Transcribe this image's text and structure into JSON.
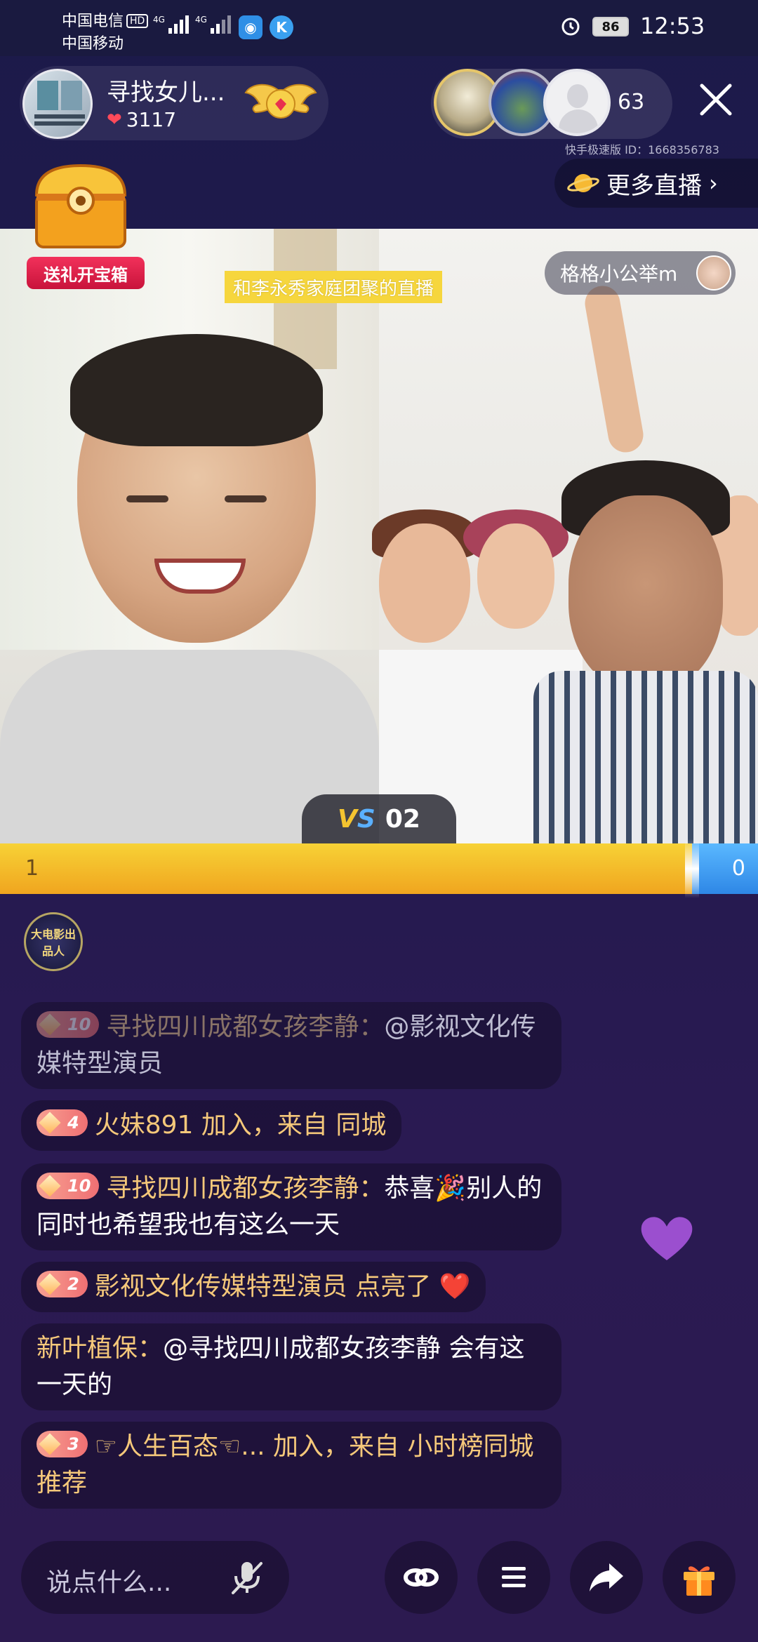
{
  "status_bar": {
    "carrier1": "中国电信",
    "carrier1_hd": "HD",
    "carrier2": "中国移动",
    "net1": "4G",
    "net2": "4G",
    "battery": "86",
    "time": "12:53"
  },
  "host": {
    "name": "寻找女儿...",
    "likes": "3117"
  },
  "viewers": {
    "count": "63",
    "live_id": "快手极速版 ID：1668356783"
  },
  "more_live_label": "更多直播",
  "treasure_label": "送礼开宝箱",
  "video": {
    "topic": "和李永秀家庭团聚的直播",
    "pk_user": "格格小公举m"
  },
  "pk": {
    "vs_round": "02",
    "left_score": "1",
    "right_score": "0"
  },
  "medal_text": "大电影出品人",
  "chat": [
    {
      "level": "10",
      "name": "寻找四川成都女孩李静：",
      "text": "@影视文化传媒特型演员"
    },
    {
      "level": "4",
      "name": "火妹891",
      "text": "加入，来自 同城"
    },
    {
      "level": "10",
      "name": "寻找四川成都女孩李静：",
      "text": "恭喜🎉别人的同时也希望我也有这么一天"
    },
    {
      "level": "2",
      "name": "影视文化传媒特型演员",
      "text": "点亮了 ❤️"
    },
    {
      "name": "新叶植保：",
      "text": "@寻找四川成都女孩李静 会有这一天的"
    },
    {
      "level": "3",
      "name": "☞人生百态☜...",
      "text": "加入，来自 小时榜同城推荐"
    }
  ],
  "bottom": {
    "input_placeholder": "说点什么..."
  },
  "colors": {
    "pk_left": "#f5c02a",
    "pk_right": "#3b97f0",
    "name_gold": "#f5c87a",
    "topic_bg": "#f6d63d"
  }
}
